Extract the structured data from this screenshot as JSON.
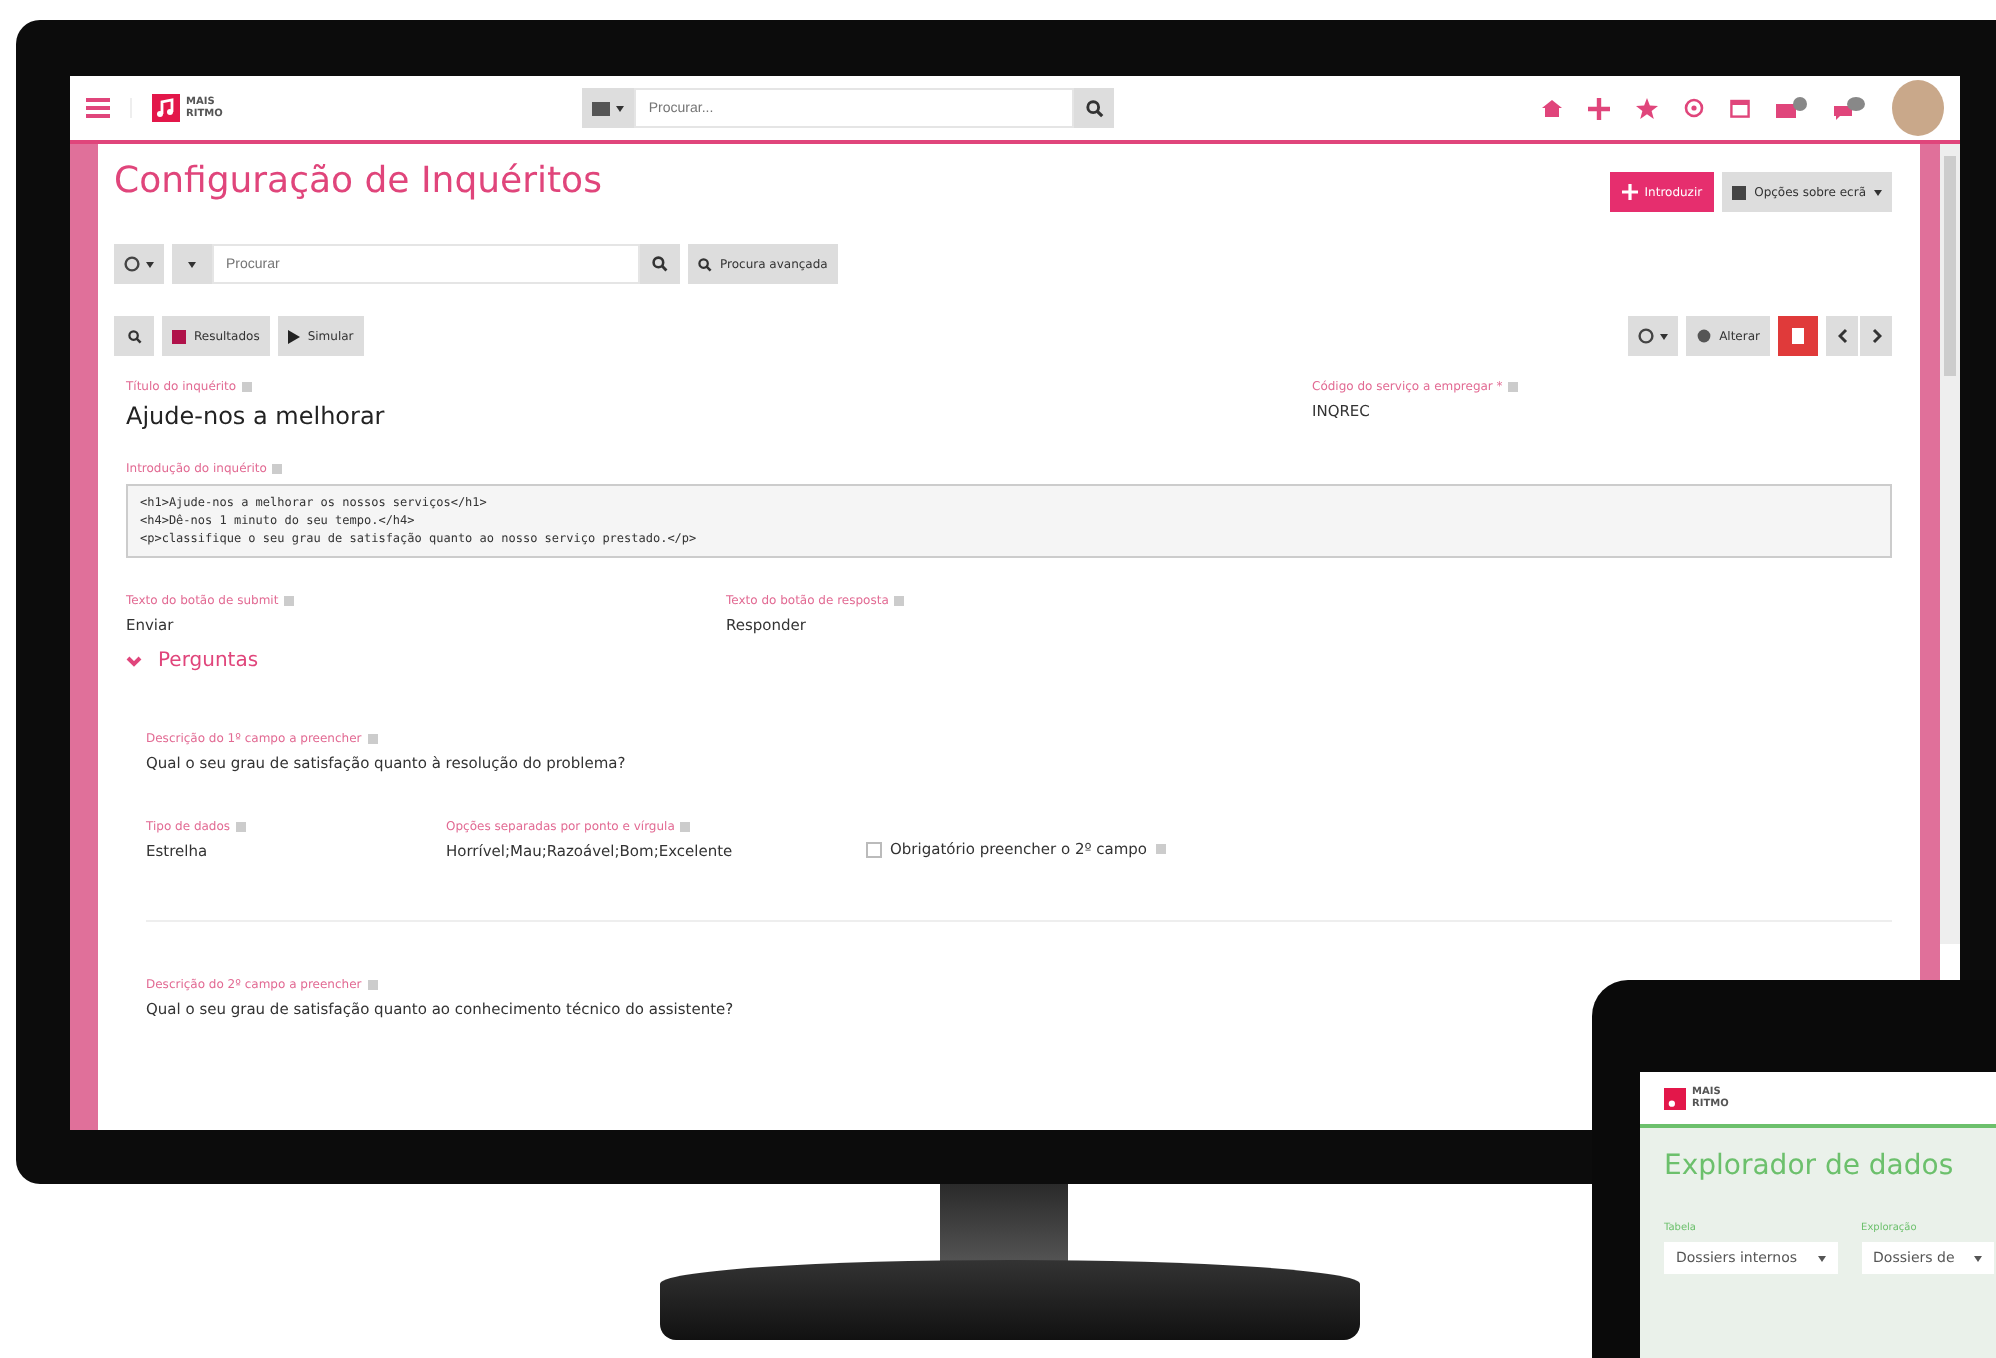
{
  "topbar": {
    "logo_lines": [
      "MAIS",
      "RITMO"
    ],
    "search": {
      "placeholder": "Procurar..."
    },
    "notifications": [
      {
        "kind": "home"
      },
      {
        "kind": "plus"
      },
      {
        "kind": "star"
      },
      {
        "kind": "target"
      },
      {
        "kind": "calendar"
      },
      {
        "kind": "mail"
      },
      {
        "kind": "chat"
      }
    ]
  },
  "page": {
    "title": "Configuração de Inquéritos",
    "primary_action": "Introduzir",
    "options_action": "Opções sobre ecrã"
  },
  "filter": {
    "placeholder": "Procurar",
    "advanced": "Procura avançada"
  },
  "toolbar": {
    "results": "Resultados",
    "simulate": "Simular",
    "edit": "Alterar"
  },
  "survey_title": {
    "label": "Título do inquérito",
    "value": "Ajude-nos a melhorar"
  },
  "service_code": {
    "label": "Código do serviço a empregar *",
    "value": "INQREC"
  },
  "intro": {
    "label": "Introdução do inquérito",
    "lines": [
      "<h1>Ajude-nos a melhorar os nossos serviços</h1>",
      "<h4>Dê-nos 1 minuto do seu tempo.</h4>",
      "<p>classifique o seu grau de satisfação quanto ao nosso serviço prestado.</p>"
    ]
  },
  "buttons_row": [
    {
      "label": "Texto do botão de submit",
      "value": "Enviar"
    },
    {
      "label": "Texto do botão de resposta",
      "value": "Responder"
    }
  ],
  "section": {
    "title": "Perguntas",
    "expanded": true
  },
  "questions": [
    {
      "label": "Descrição do 1º campo a preencher",
      "value": "Qual o seu grau de satisfação quanto à resolução do problema?",
      "type_label": "Tipo de dados",
      "type_value": "Estrelha",
      "options_label": "Opções separadas por ponto e vírgula",
      "options_value": "Horrível;Mau;Razoável;Bom;Excelente",
      "required_label": "Obrigatório preencher o 2º campo",
      "required": false
    },
    {
      "label": "Descrição do 2º campo a preencher",
      "value": "Qual o seu grau de satisfação quanto ao conhecimento técnico do assistente?"
    }
  ],
  "tablet": {
    "logo_lines": [
      "MAIS",
      "RITMO"
    ],
    "title": "Explorador de dados",
    "fields": [
      {
        "label": "Tabela",
        "value": "Dossiers internos"
      },
      {
        "label": "Exploração",
        "value": "Dossiers de"
      }
    ]
  }
}
